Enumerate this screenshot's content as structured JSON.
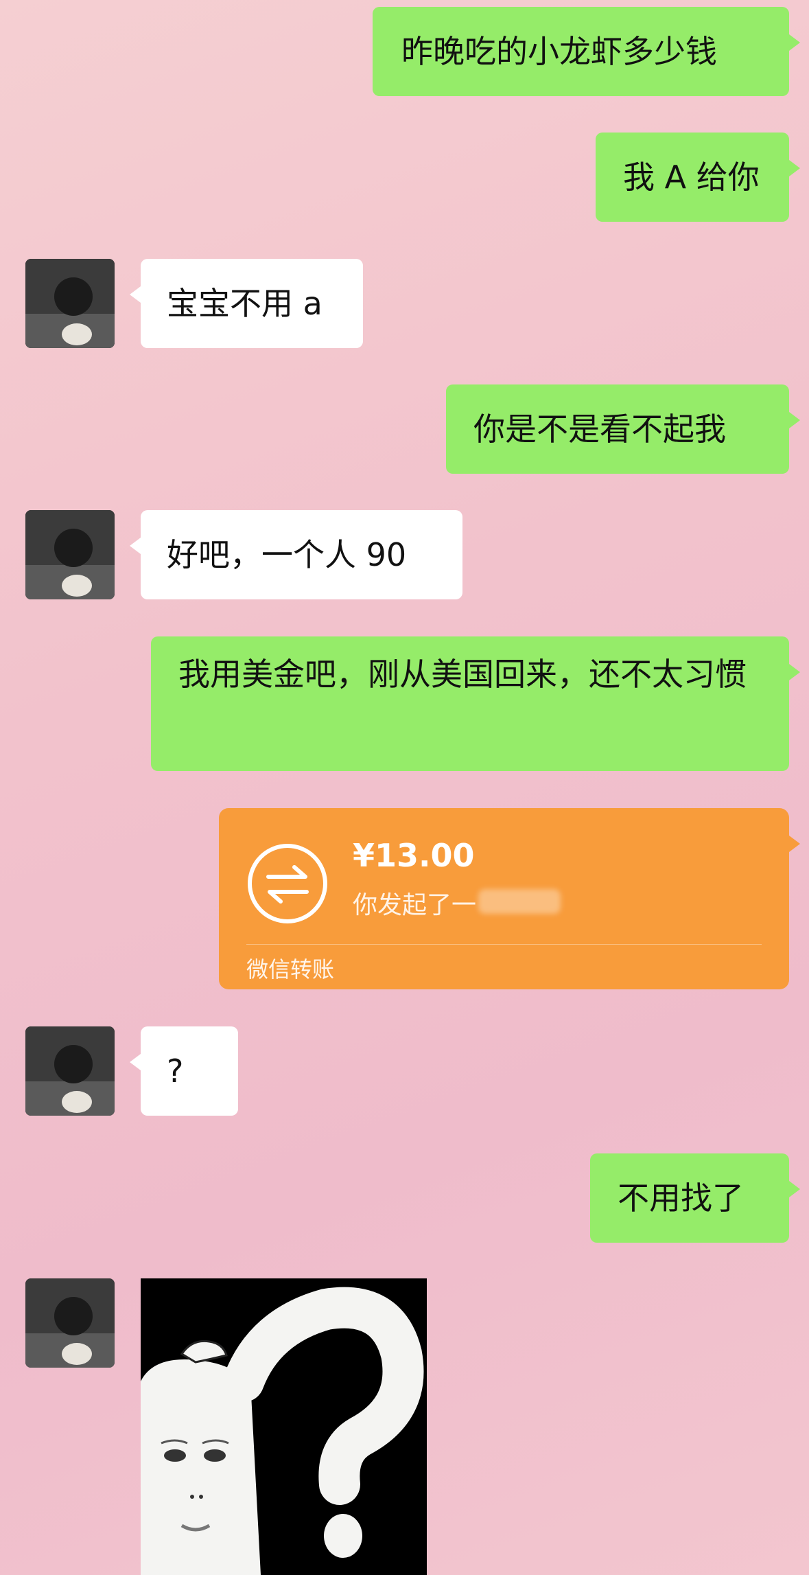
{
  "chat": {
    "messages": [
      {
        "text": "昨晚吃的小龙虾多少钱"
      },
      {
        "text": "我 A 给你"
      },
      {
        "text": "宝宝不用 a"
      },
      {
        "text": "你是不是看不起我"
      },
      {
        "text": "好吧，一个人 90"
      },
      {
        "text": "我用美金吧，刚从美国回来，还不太习惯"
      },
      {
        "text": "?"
      },
      {
        "text": "不用找了"
      }
    ],
    "transfer": {
      "amount": "¥13.00",
      "description": "你发起了一",
      "footer": "微信转账",
      "icon": "transfer-arrows-icon"
    },
    "sticker": {
      "icon": "confused-question-meme"
    },
    "colors": {
      "my_bubble": "#95ec69",
      "their_bubble": "#ffffff",
      "transfer_card": "#f89c3b"
    }
  }
}
